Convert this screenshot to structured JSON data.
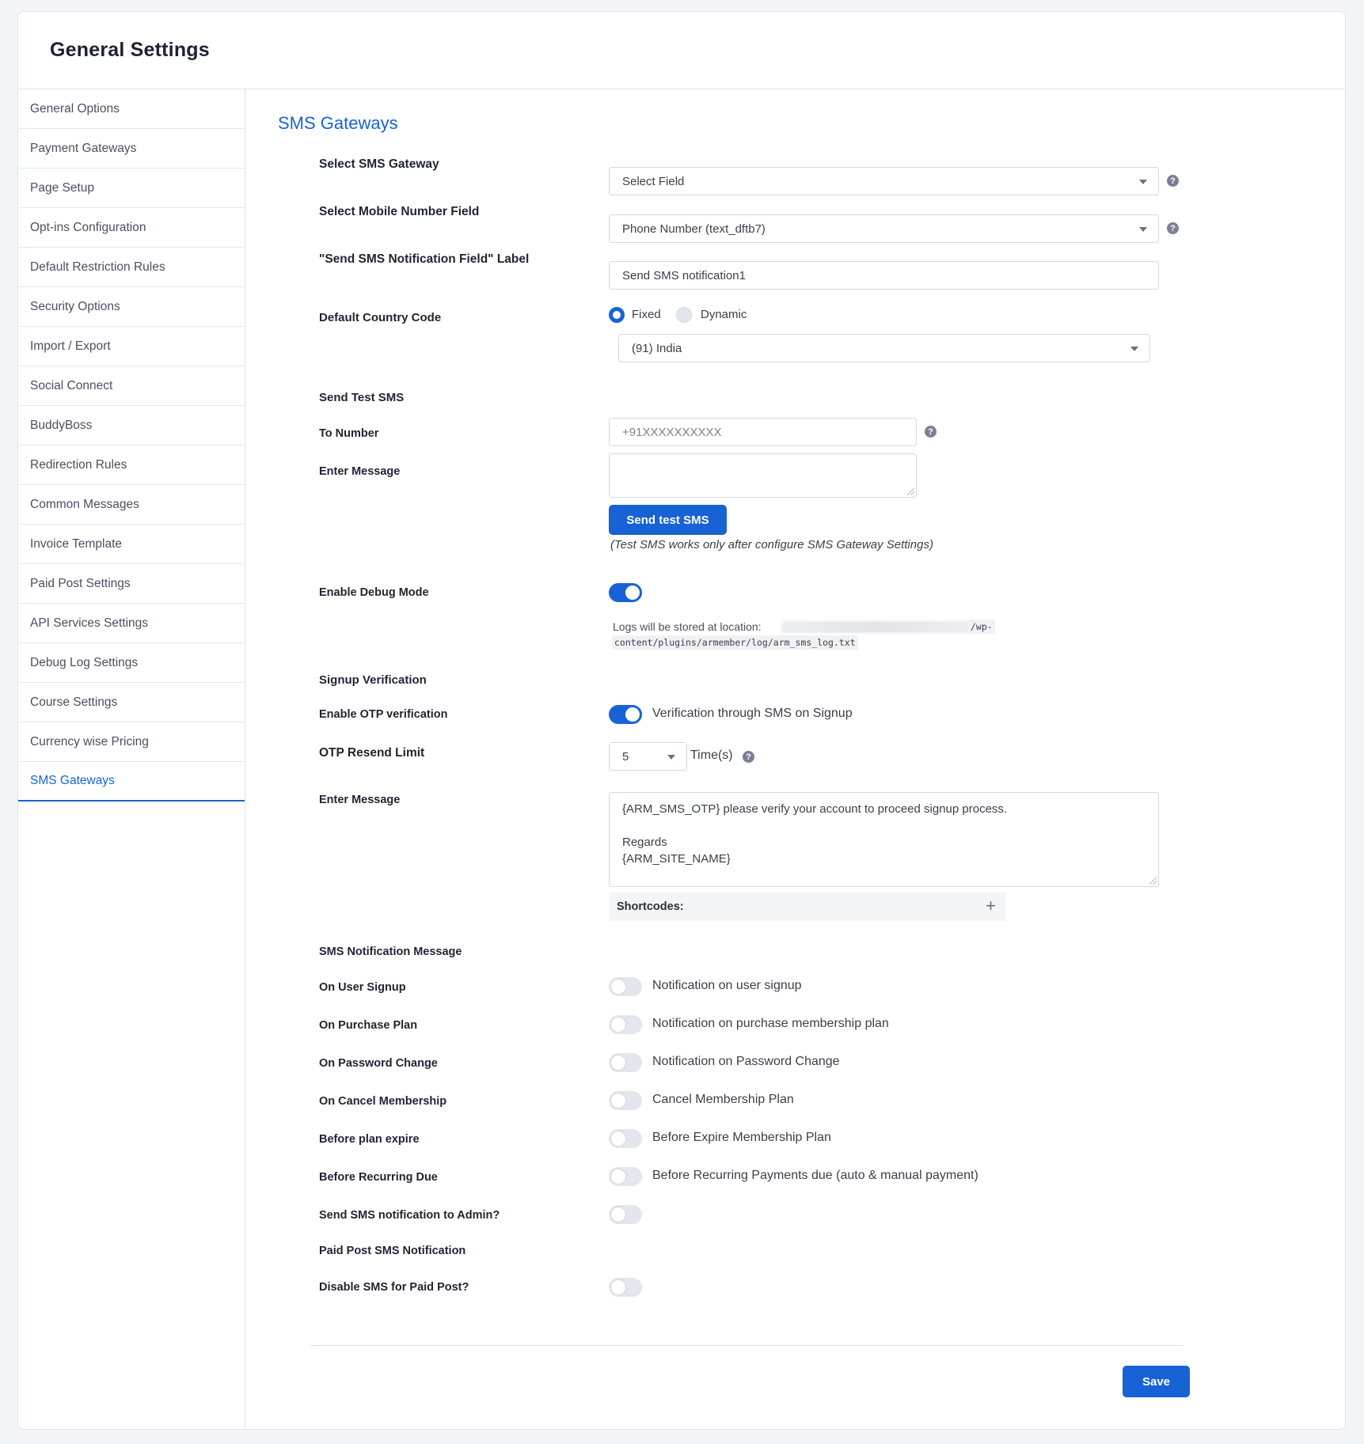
{
  "header": {
    "title": "General Settings"
  },
  "sidebar": {
    "items": [
      {
        "label": "General Options"
      },
      {
        "label": "Payment Gateways"
      },
      {
        "label": "Page Setup"
      },
      {
        "label": "Opt-ins Configuration"
      },
      {
        "label": "Default Restriction Rules"
      },
      {
        "label": "Security Options"
      },
      {
        "label": "Import / Export"
      },
      {
        "label": "Social Connect"
      },
      {
        "label": "BuddyBoss"
      },
      {
        "label": "Redirection Rules"
      },
      {
        "label": "Common Messages"
      },
      {
        "label": "Invoice Template"
      },
      {
        "label": "Paid Post Settings"
      },
      {
        "label": "API Services Settings"
      },
      {
        "label": "Debug Log Settings"
      },
      {
        "label": "Course Settings"
      },
      {
        "label": "Currency wise Pricing"
      },
      {
        "label": "SMS Gateways"
      }
    ],
    "active": "SMS Gateways"
  },
  "main": {
    "section_title": "SMS Gateways",
    "gateway": {
      "label": "Select SMS Gateway",
      "value": "Select Field"
    },
    "mobile_field": {
      "label": "Select Mobile Number Field",
      "value": "Phone Number (text_dftb7)"
    },
    "notification_label": {
      "label": "\"Send SMS Notification Field\" Label",
      "value": "Send SMS notification1"
    },
    "country_code": {
      "label": "Default Country Code",
      "options": [
        "Fixed",
        "Dynamic"
      ],
      "selected": "Fixed",
      "value": "(91) India"
    },
    "test_sms": {
      "heading": "Send Test SMS",
      "to_label": "To Number",
      "to_placeholder": "+91XXXXXXXXXX",
      "message_label": "Enter Message",
      "button": "Send test SMS",
      "note": "(Test SMS works only after configure SMS Gateway Settings)"
    },
    "debug": {
      "label": "Enable Debug Mode",
      "enabled": true,
      "log_prefix": "Logs will be stored at location:",
      "log_path_tail": "/wp-",
      "log_path": "content/plugins/armember/log/arm_sms_log.txt"
    },
    "signup": {
      "heading": "Signup Verification",
      "otp_label": "Enable OTP verification",
      "otp_enabled": true,
      "otp_text": "Verification through SMS on Signup",
      "resend_label": "OTP Resend Limit",
      "resend_value": "5",
      "resend_unit": "Time(s)",
      "message_label": "Enter Message",
      "message_line1": "{ARM_SMS_OTP} please verify your account to proceed signup process.",
      "message_line2": "Regards",
      "message_line3": "{ARM_SITE_NAME}",
      "shortcodes": "Shortcodes:"
    },
    "notifications": {
      "heading": "SMS Notification Message",
      "rows": [
        {
          "label": "On User Signup",
          "text": "Notification on user signup",
          "enabled": false
        },
        {
          "label": "On Purchase Plan",
          "text": "Notification on purchase membership plan",
          "enabled": false
        },
        {
          "label": "On Password Change",
          "text": "Notification on Password Change",
          "enabled": false
        },
        {
          "label": "On Cancel Membership",
          "text": "Cancel Membership Plan",
          "enabled": false
        },
        {
          "label": "Before plan expire",
          "text": "Before Expire Membership Plan",
          "enabled": false
        },
        {
          "label": "Before Recurring Due",
          "text": "Before Recurring Payments due (auto & manual payment)",
          "enabled": false
        }
      ],
      "admin_label": "Send SMS notification to Admin?",
      "admin_enabled": false
    },
    "paid_post": {
      "heading": "Paid Post SMS Notification",
      "disable_label": "Disable SMS for Paid Post?",
      "disable_enabled": false
    },
    "save_label": "Save"
  },
  "colors": {
    "accent": "#1763d6",
    "toggle_off": "#e3e6ec"
  }
}
